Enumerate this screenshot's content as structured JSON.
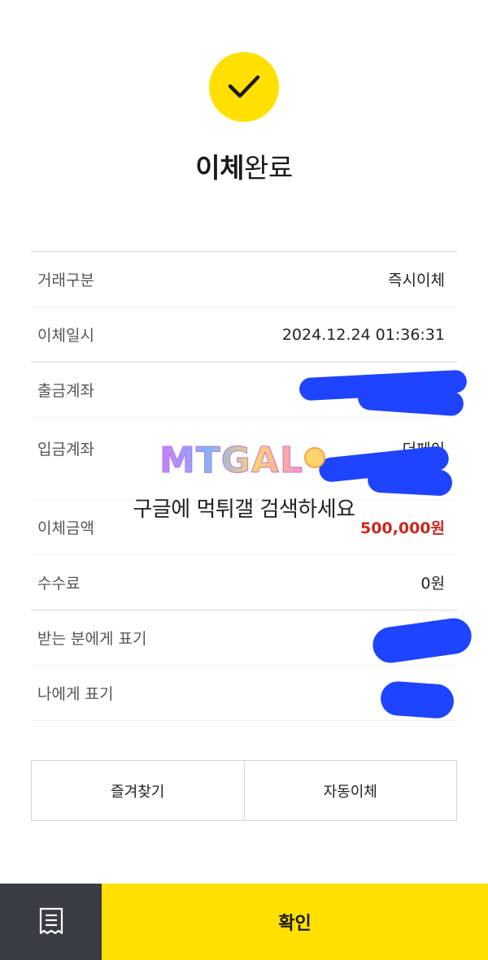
{
  "title": {
    "bold": "이체",
    "rest": "완료"
  },
  "details": [
    {
      "label": "거래구분",
      "value": "즉시이체"
    },
    {
      "label": "이체일시",
      "value": "2024.12.24 01:36:31"
    },
    {
      "label": "출금계좌",
      "value": ""
    },
    {
      "label": "입금계좌",
      "value": "더페이"
    },
    {
      "label": "이체금액",
      "value": "500,000원"
    },
    {
      "label": "수수료",
      "value": "0원"
    },
    {
      "label": "받는 분에게 표기",
      "value": ""
    },
    {
      "label": "나에게 표기",
      "value": ""
    }
  ],
  "watermark": {
    "logo": "MTGAL",
    "caption": "구글에 먹튀갤 검색하세요"
  },
  "actions": {
    "favorite": "즐겨찾기",
    "auto_transfer": "자동이체"
  },
  "bottom": {
    "confirm": "확인",
    "receipt_icon": "receipt-icon"
  },
  "colors": {
    "accent": "#FFE000",
    "amount": "#c8281f",
    "dark": "#3a3d44",
    "redaction": "#1f44ff"
  }
}
